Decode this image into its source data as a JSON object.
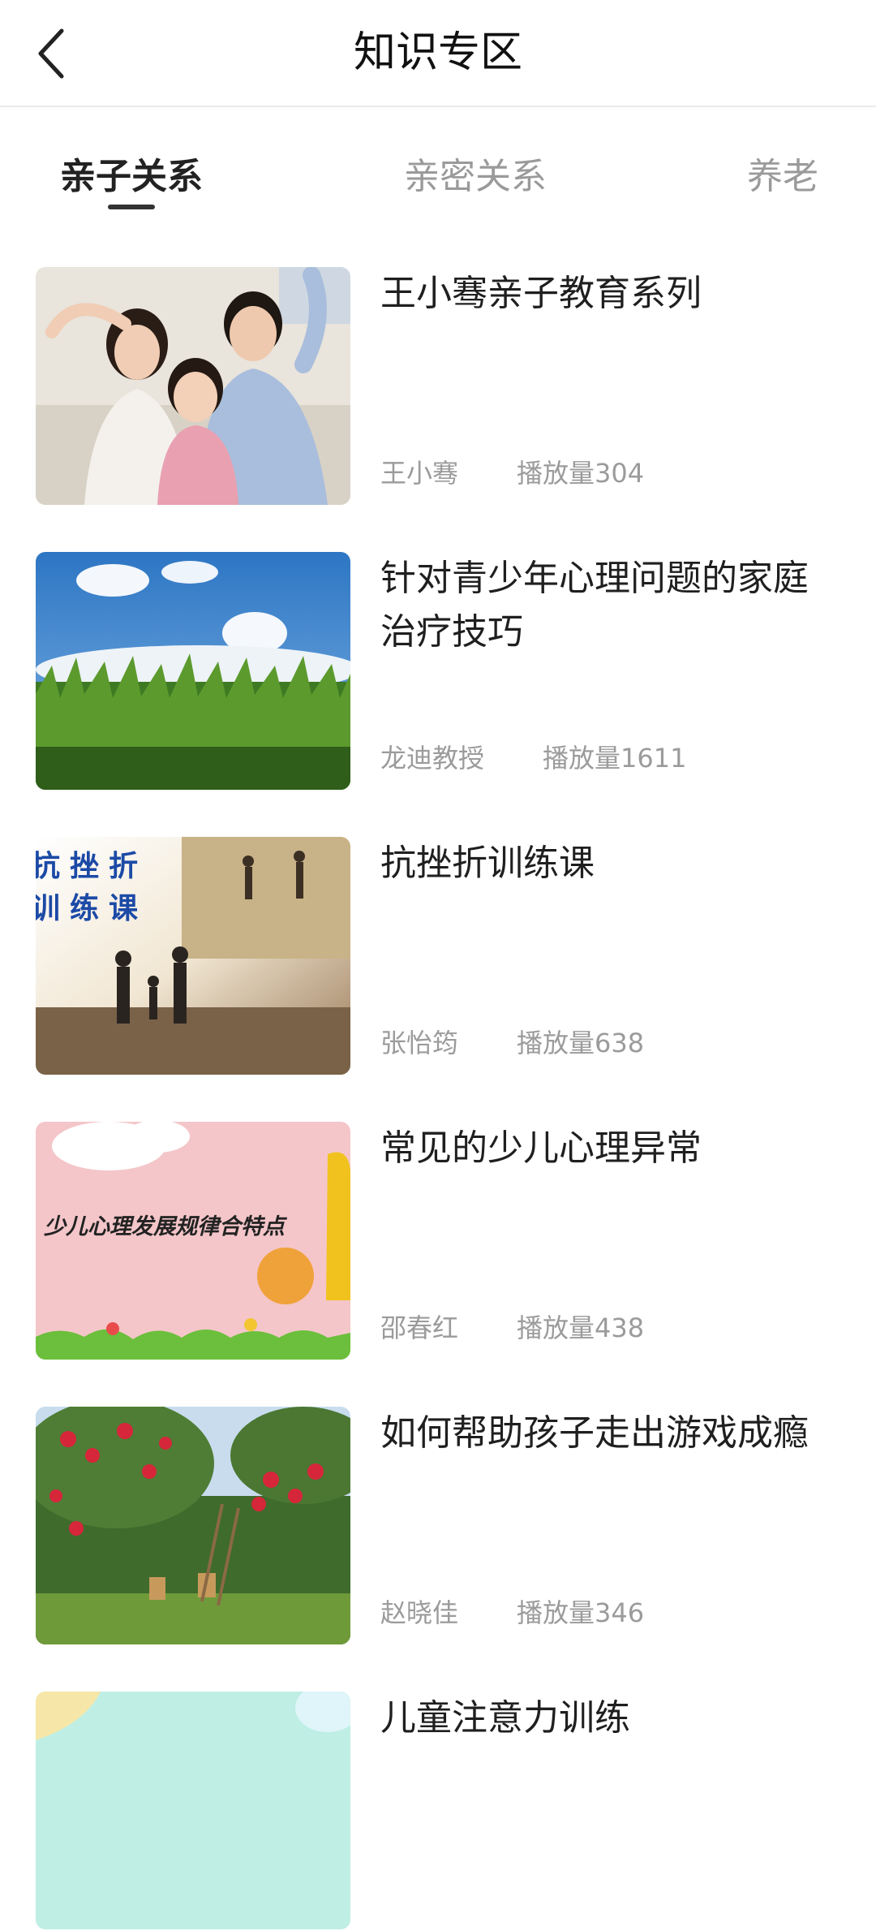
{
  "header": {
    "title": "知识专区"
  },
  "tabs": [
    {
      "label": "亲子关系",
      "active": true
    },
    {
      "label": "亲密关系",
      "active": false
    },
    {
      "label": "养老",
      "active": false
    }
  ],
  "items": [
    {
      "title": "王小骞亲子教育系列",
      "author": "王小骞",
      "plays": "播放量304",
      "thumb": "family-photo"
    },
    {
      "title": "针对青少年心理问题的家庭治疗技巧",
      "author": "龙迪教授",
      "plays": "播放量1611",
      "thumb": "corn-field-sky"
    },
    {
      "title": "抗挫折训练课",
      "author": "张怡筠",
      "plays": "播放量638",
      "thumb_text": "抗挫折 训练课",
      "thumb": "family-silhouette"
    },
    {
      "title": "常见的少儿心理异常",
      "author": "邵春红",
      "plays": "播放量438",
      "thumb_text": "少儿心理发展规律合特点",
      "thumb": "pink-cartoon"
    },
    {
      "title": "如何帮助孩子走出游戏成瘾",
      "author": "赵晓佳",
      "plays": "播放量346",
      "thumb": "apple-orchard"
    },
    {
      "title": "儿童注意力训练",
      "author": "",
      "plays": "",
      "thumb": "teal-cartoon"
    }
  ]
}
